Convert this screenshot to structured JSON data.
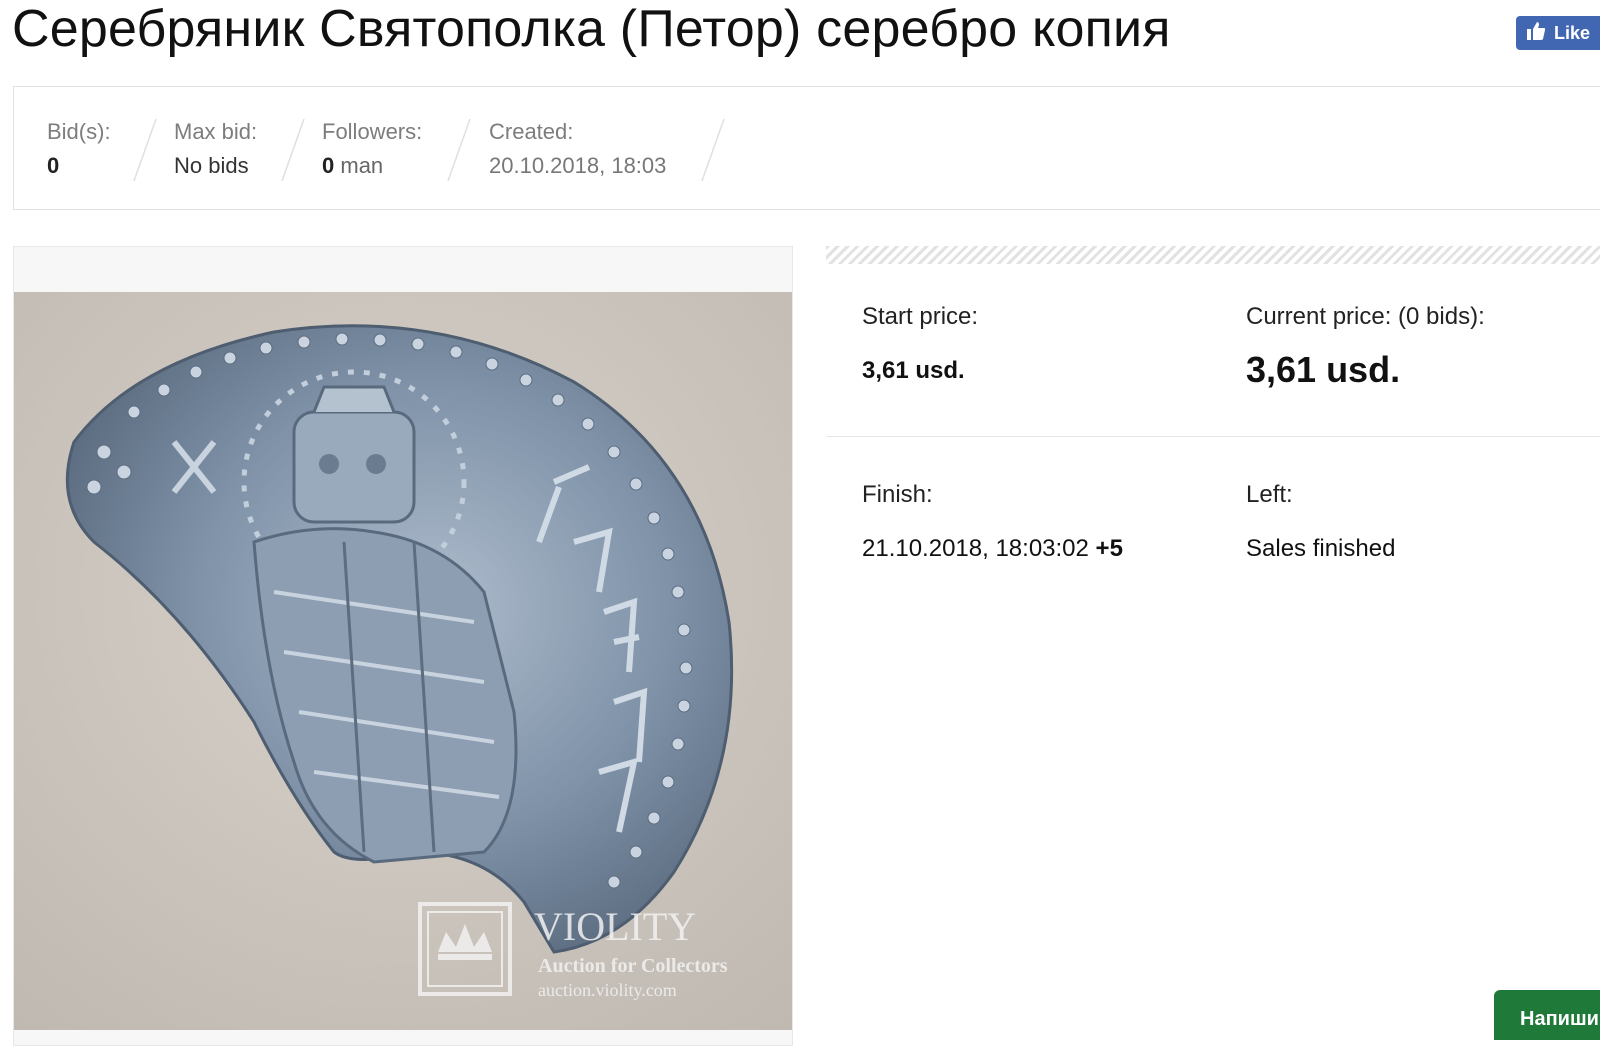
{
  "title": "Серебряник Святополка (Петор) серебро копия",
  "fb_like_label": "Like",
  "stats": {
    "bids_label": "Bid(s):",
    "bids_value": "0",
    "max_bid_label": "Max bid:",
    "max_bid_value": "No bids",
    "followers_label": "Followers:",
    "followers_count": "0",
    "followers_unit": "man",
    "created_label": "Created:",
    "created_value": "20.10.2018, 18:03"
  },
  "image": {
    "watermark_title": "VIOLITY",
    "watermark_sub": "Auction for Collectors",
    "watermark_url": "auction.violity.com"
  },
  "price": {
    "start_label": "Start price:",
    "start_value": "3,61 usd.",
    "current_label": "Current price: (0 bids):",
    "current_value": "3,61 usd."
  },
  "finish": {
    "finish_label": "Finish:",
    "finish_value": "21.10.2018, 18:03:02",
    "finish_tz": "+5",
    "left_label": "Left:",
    "left_value": "Sales finished"
  },
  "chat_button_label": "Напиши",
  "colors": {
    "fb_blue": "#4267b2",
    "chat_green": "#1f7a3a",
    "photo_bg": "#cfc9c2",
    "coin_silver": "#7f92a8"
  },
  "icons": {
    "like": "thumbs-up-icon",
    "watermark": "crown-icon"
  }
}
